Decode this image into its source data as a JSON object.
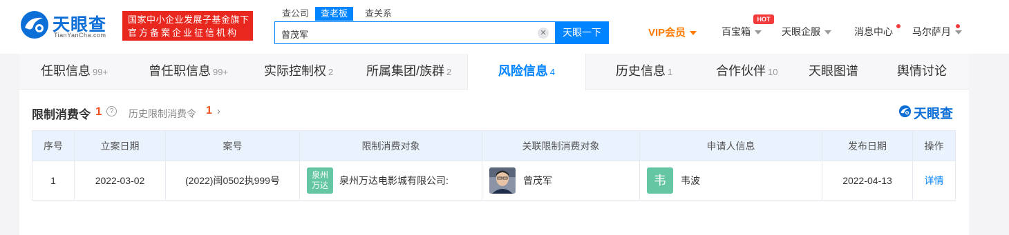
{
  "header": {
    "logo_text": "天眼查",
    "logo_sub": "TianYanCha.com",
    "badge_line1": "国家中小企业发展子基金旗下",
    "badge_line2": "官方备案企业征信机构",
    "search_tabs": [
      "查公司",
      "查老板",
      "查关系"
    ],
    "search_value": "曾茂军",
    "search_button": "天眼一下",
    "vip_label": "VIP会员",
    "hot_badge": "HOT",
    "nav_items": [
      "百宝箱",
      "天眼企服",
      "消息中心",
      "马尔萨月"
    ]
  },
  "tabs": [
    {
      "label": "任职信息",
      "count": "99+"
    },
    {
      "label": "曾任职信息",
      "count": "99+"
    },
    {
      "label": "实际控制权",
      "count": "2"
    },
    {
      "label": "所属集团/族群",
      "count": "2"
    },
    {
      "label": "风险信息",
      "count": "4"
    },
    {
      "label": "历史信息",
      "count": "1"
    },
    {
      "label": "合作伙伴",
      "count": "10"
    },
    {
      "label": "天眼图谱",
      "count": ""
    },
    {
      "label": "舆情讨论",
      "count": ""
    }
  ],
  "section": {
    "title": "限制消费令",
    "count": "1",
    "help_icon": "?",
    "history_label": "历史限制消费令",
    "history_count": "1",
    "history_arrow": "›",
    "brand": "天眼查"
  },
  "table": {
    "headers": [
      "序号",
      "立案日期",
      "案号",
      "限制消费对象",
      "关联限制消费对象",
      "申请人信息",
      "发布日期",
      "操作"
    ],
    "rows": [
      {
        "index": "1",
        "filing_date": "2022-03-02",
        "case_no": "(2022)闽0502执999号",
        "target_logo": "泉州万达",
        "target_logo_line1": "泉州",
        "target_logo_line2": "万达",
        "target": "泉州万达电影城有限公司:",
        "related": "曾茂军",
        "applicant_char": "韦",
        "applicant": "韦波",
        "publish_date": "2022-04-13",
        "action": "详情"
      }
    ]
  },
  "colors": {
    "primary": "#0084ff",
    "brand": "#0c6fd8",
    "badge_red": "#e8281f",
    "vip_orange": "#ff7a00",
    "count_red": "#f0511e",
    "logo_green": "#64c6a2",
    "table_header_bg": "#eaf3fd"
  }
}
